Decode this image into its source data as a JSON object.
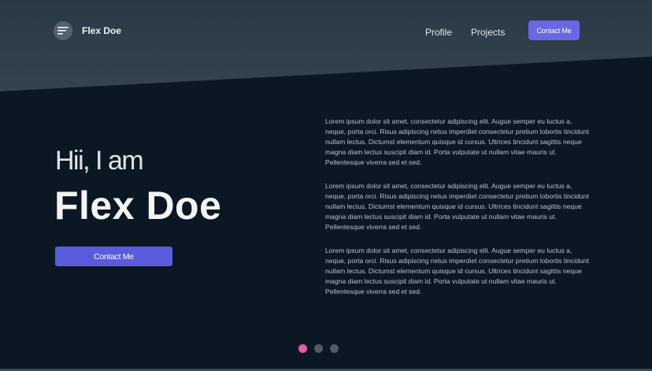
{
  "header": {
    "brand": "Flex Doe",
    "nav": [
      {
        "label": "Profile"
      },
      {
        "label": "Projects"
      }
    ],
    "contact_label": "Contact Me"
  },
  "hero": {
    "greeting": "Hii, I am",
    "name": "Flex Doe",
    "contact_label": "Contact Me"
  },
  "paragraphs": [
    "Lorem ipsum dolor sit amet, consectetur adipiscing elit. Augue semper eu luctus a, neque, porta orci. Risus adipiscing netus imperdiet consectetur pretium lobortis tincidunt nullam lectus. Dictumst elementum quisque id cursus. Ultrices tincidunt sagittis neque magna diam lectus suscipit diam id. Porta vulputate ut nullam vitae mauris ut. Pellentesque viverra sed et sed.",
    "Lorem ipsum dolor sit amet, consectetur adipiscing elit. Augue semper eu luctus a, neque, porta orci. Risus adipiscing netus imperdiet consectetur pretium lobortis tincidunt nullam lectus. Dictumst elementum quisque id cursus. Ultrices tincidunt sagittis neque magna diam lectus suscipit diam id. Porta vulputate ut nullam vitae mauris ut. Pellentesque viverra sed et sed.",
    "Lorem ipsum dolor sit amet, consectetur adipiscing elit. Augue semper eu luctus a, neque, porta orci. Risus adipiscing netus imperdiet consectetur pretium lobortis tincidunt nullam lectus. Dictumst elementum quisque id cursus. Ultrices tincidunt sagittis neque magna diam lectus suscipit diam id. Porta vulputate ut nullam vitae mauris ut. Pellentesque viverra sed et sed."
  ],
  "carousel": {
    "count": 3,
    "active_index": 0
  },
  "colors": {
    "background": "#0b1722",
    "header": "#35434f",
    "accent": "#6a66e6",
    "active_dot": "#e85aa5"
  },
  "icons": {
    "logo": "menu-lines-icon"
  }
}
